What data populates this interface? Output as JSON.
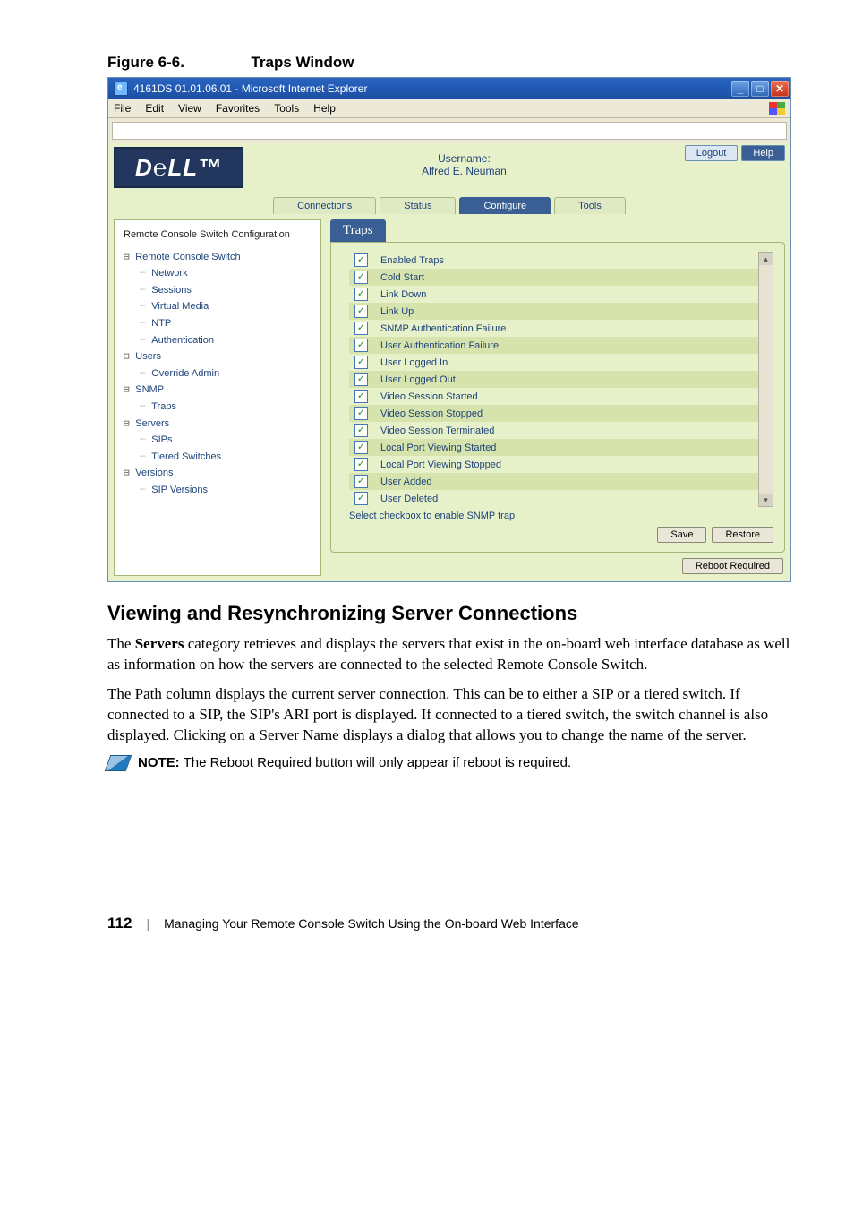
{
  "figure": {
    "label": "Figure 6-6.",
    "title": "Traps Window"
  },
  "window": {
    "title": "4161DS 01.01.06.01 - Microsoft Internet Explorer",
    "menu": [
      "File",
      "Edit",
      "View",
      "Favorites",
      "Tools",
      "Help"
    ]
  },
  "app": {
    "logo_text": "D℮LL™",
    "username_label": "Username:",
    "username_value": "Alfred E. Neuman",
    "topbuttons": {
      "logout": "Logout",
      "help": "Help"
    },
    "tabs": [
      {
        "label": "Connections",
        "active": false
      },
      {
        "label": "Status",
        "active": false
      },
      {
        "label": "Configure",
        "active": true
      },
      {
        "label": "Tools",
        "active": false
      }
    ],
    "tree": {
      "header": "Remote Console Switch Configuration",
      "items": [
        {
          "label": "Remote Console Switch",
          "expand": true,
          "children": [
            {
              "label": "Network"
            },
            {
              "label": "Sessions"
            },
            {
              "label": "Virtual Media"
            },
            {
              "label": "NTP"
            },
            {
              "label": "Authentication"
            }
          ]
        },
        {
          "label": "Users",
          "expand": true,
          "children": [
            {
              "label": "Override Admin"
            }
          ]
        },
        {
          "label": "SNMP",
          "expand": true,
          "children": [
            {
              "label": "Traps"
            }
          ]
        },
        {
          "label": "Servers",
          "expand": true,
          "children": [
            {
              "label": "SIPs"
            },
            {
              "label": "Tiered Switches"
            }
          ]
        },
        {
          "label": "Versions",
          "expand": true,
          "children": [
            {
              "label": "SIP Versions"
            }
          ]
        }
      ]
    },
    "traps": {
      "title": "Traps",
      "header_row": "Enabled Traps",
      "rows": [
        "Cold Start",
        "Link Down",
        "Link Up",
        "SNMP Authentication Failure",
        "User Authentication Failure",
        "User Logged In",
        "User Logged Out",
        "Video Session Started",
        "Video Session Stopped",
        "Video Session Terminated",
        "Local Port Viewing Started",
        "Local Port Viewing Stopped",
        "User Added",
        "User Deleted"
      ],
      "hint": "Select checkbox to enable SNMP trap",
      "save": "Save",
      "restore": "Restore",
      "reboot": "Reboot Required"
    }
  },
  "doc": {
    "h2": "Viewing and Resynchronizing Server Connections",
    "p1a": "The ",
    "p1b": "Servers",
    "p1c": " category retrieves and displays the servers that exist in the on-board web interface database as well as information on how the servers are connected to the selected Remote Console Switch.",
    "p2": "The Path column displays the current server connection. This can be to either a SIP or a tiered switch. If connected to a SIP, the SIP's ARI port is displayed. If connected to a tiered switch, the switch channel is also displayed. Clicking on a Server Name displays a dialog that allows you to change the name of the server.",
    "note_label": "NOTE:",
    "note_text": " The Reboot Required button will only appear if reboot is required."
  },
  "footer": {
    "page": "112",
    "chapter": "Managing Your Remote Console Switch Using the On-board Web Interface"
  }
}
